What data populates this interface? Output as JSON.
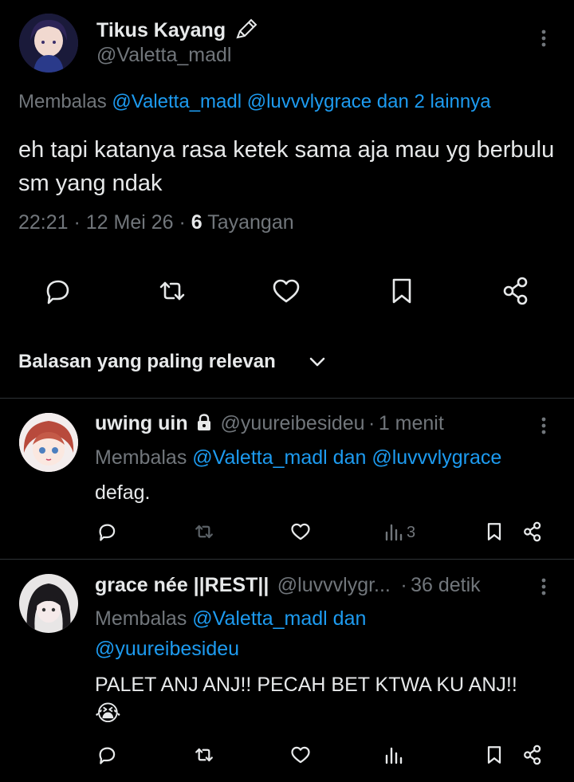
{
  "main_tweet": {
    "display_name": "Tikus Kayang",
    "name_badge_icon": "pencil-icon",
    "handle": "@Valetta_madl",
    "replying_prefix": "Membalas",
    "replying_mentions": "@Valetta_madl @luvvvlygrace dan 2 lainnya",
    "text": "eh tapi katanya rasa ketek sama aja mau yg berbulu sm yang ndak",
    "time": "22:21",
    "date": "12 Mei 26",
    "views_count": "6",
    "views_label": "Tayangan",
    "actions": [
      "reply-icon",
      "retweet-icon",
      "like-icon",
      "bookmark-icon",
      "share-icon"
    ]
  },
  "sort": {
    "label": "Balasan yang paling relevan"
  },
  "replies": [
    {
      "display_name": "uwing uin",
      "protected_icon": "lock-icon",
      "handle": "@yuureibesideu",
      "separator": "·",
      "time": "1 menit",
      "replying_prefix": "Membalas",
      "replying_mentions": "@Valetta_madl dan @luvvvlygrace",
      "text": "defag.",
      "views": "3"
    },
    {
      "display_name": "grace née ||REST||",
      "handle": "@luvvvlygr...",
      "separator": "·",
      "time": "36 detik",
      "replying_prefix": "Membalas",
      "replying_mentions_line1": "@Valetta_madl dan",
      "replying_mentions_line2": "@yuureibesideu",
      "text": "PALET ANJ ANJ!! PECAH BET KTWA KU ANJ!!",
      "emoji": "😭",
      "views": ""
    }
  ],
  "colors": {
    "background": "#000000",
    "text": "#e7e9ea",
    "muted": "#71767b",
    "link": "#1d9bf0",
    "divider": "#2f3336"
  }
}
